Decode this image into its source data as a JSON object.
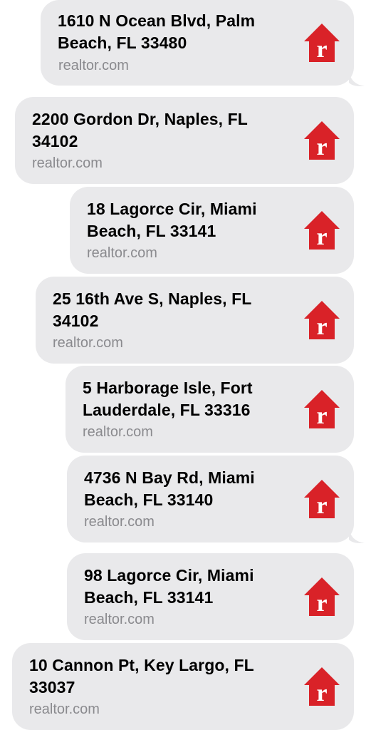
{
  "messages": [
    {
      "address": "1610 N Ocean Blvd, Palm Beach, FL 33480",
      "line1": "1610 N Ocean Blvd, Palm",
      "line2": "Beach, FL 33480",
      "source": "realtor.com",
      "logo_icon": "realtor-house-logo-icon"
    },
    {
      "address": "2200 Gordon Dr, Naples, FL 34102",
      "line1": "2200 Gordon Dr, Naples, FL",
      "line2": "34102",
      "source": "realtor.com",
      "logo_icon": "realtor-house-logo-icon"
    },
    {
      "address": "18 Lagorce Cir, Miami Beach, FL 33141",
      "line1": "18 Lagorce Cir, Miami",
      "line2": "Beach, FL 33141",
      "source": "realtor.com",
      "logo_icon": "realtor-house-logo-icon"
    },
    {
      "address": "25 16th Ave S, Naples, FL 34102",
      "line1": "25 16th Ave S, Naples, FL",
      "line2": "34102",
      "source": "realtor.com",
      "logo_icon": "realtor-house-logo-icon"
    },
    {
      "address": "5 Harborage Isle, Fort Lauderdale, FL 33316",
      "line1": "5 Harborage Isle, Fort",
      "line2": "Lauderdale, FL 33316",
      "source": "realtor.com",
      "logo_icon": "realtor-house-logo-icon"
    },
    {
      "address": "4736 N Bay Rd, Miami Beach, FL 33140",
      "line1": "4736 N Bay Rd, Miami",
      "line2": "Beach, FL 33140",
      "source": "realtor.com",
      "logo_icon": "realtor-house-logo-icon"
    },
    {
      "address": "98 Lagorce Cir, Miami Beach, FL 33141",
      "line1": "98 Lagorce Cir, Miami",
      "line2": "Beach, FL 33141",
      "source": "realtor.com",
      "logo_icon": "realtor-house-logo-icon"
    },
    {
      "address": "10 Cannon Pt, Key Largo, FL 33037",
      "line1": "10 Cannon Pt, Key Largo, FL",
      "line2": "33037",
      "source": "realtor.com",
      "logo_icon": "realtor-house-logo-icon"
    }
  ],
  "colors": {
    "bubble": "#e9e9eb",
    "brand_red": "#d92228",
    "source_gray": "#8a8a8e"
  }
}
